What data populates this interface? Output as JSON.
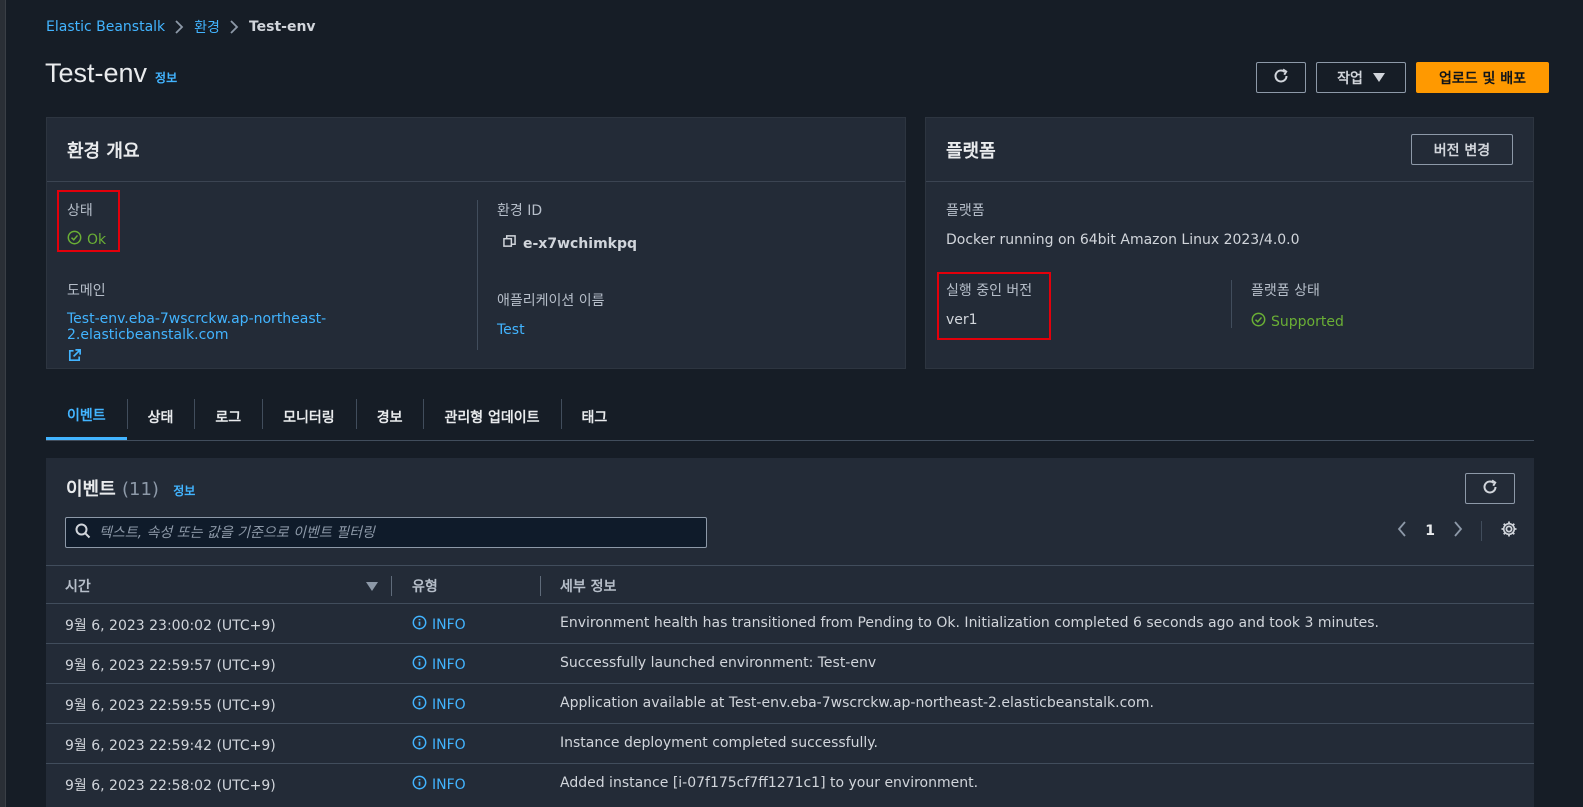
{
  "breadcrumb": {
    "root": "Elastic Beanstalk",
    "env_group": "환경",
    "current": "Test-env"
  },
  "page": {
    "title": "Test-env",
    "info": "정보"
  },
  "actions": {
    "refresh_icon": "refresh-icon",
    "actions_label": "작업",
    "deploy_label": "업로드 및 배포"
  },
  "overview": {
    "title": "환경 개요",
    "status_label": "상태",
    "status_value": "Ok",
    "env_id_label": "환경 ID",
    "env_id_value": "e-x7wchimkpq",
    "domain_label": "도메인",
    "domain_value": "Test-env.eba-7wscrckw.ap-northeast-2.elasticbeanstalk.com",
    "app_name_label": "애플리케이션 이름",
    "app_name_value": "Test"
  },
  "platform": {
    "title": "플랫폼",
    "change_version_label": "버전 변경",
    "platform_label": "플랫폼",
    "platform_value": "Docker running on 64bit Amazon Linux 2023/4.0.0",
    "running_version_label": "실행 중인 버전",
    "running_version_value": "ver1",
    "platform_state_label": "플랫폼 상태",
    "platform_state_value": "Supported"
  },
  "tabs": [
    {
      "label": "이벤트"
    },
    {
      "label": "상태"
    },
    {
      "label": "로그"
    },
    {
      "label": "모니터링"
    },
    {
      "label": "경보"
    },
    {
      "label": "관리형 업데이트"
    },
    {
      "label": "태그"
    }
  ],
  "events": {
    "title": "이벤트",
    "count": "(11)",
    "info": "정보",
    "search_placeholder": "텍스트, 속성 또는 값을 기준으로 이벤트 필터링",
    "page": "1",
    "columns": {
      "time": "시간",
      "type": "유형",
      "detail": "세부 정보"
    },
    "rows": [
      {
        "time": "9월 6, 2023 23:00:02 (UTC+9)",
        "type": "INFO",
        "detail": "Environment health has transitioned from Pending to Ok. Initialization completed 6 seconds ago and took 3 minutes."
      },
      {
        "time": "9월 6, 2023 22:59:57 (UTC+9)",
        "type": "INFO",
        "detail": "Successfully launched environment: Test-env"
      },
      {
        "time": "9월 6, 2023 22:59:55 (UTC+9)",
        "type": "INFO",
        "detail": "Application available at Test-env.eba-7wscrckw.ap-northeast-2.elasticbeanstalk.com."
      },
      {
        "time": "9월 6, 2023 22:59:42 (UTC+9)",
        "type": "INFO",
        "detail": "Instance deployment completed successfully."
      },
      {
        "time": "9월 6, 2023 22:58:02 (UTC+9)",
        "type": "INFO",
        "detail": "Added instance [i-07f175cf7ff1271c1] to your environment."
      }
    ]
  },
  "colors": {
    "accent": "#42b4ff",
    "primary": "#ff9900",
    "success": "#6aaf35",
    "highlight": "#e3000b"
  }
}
